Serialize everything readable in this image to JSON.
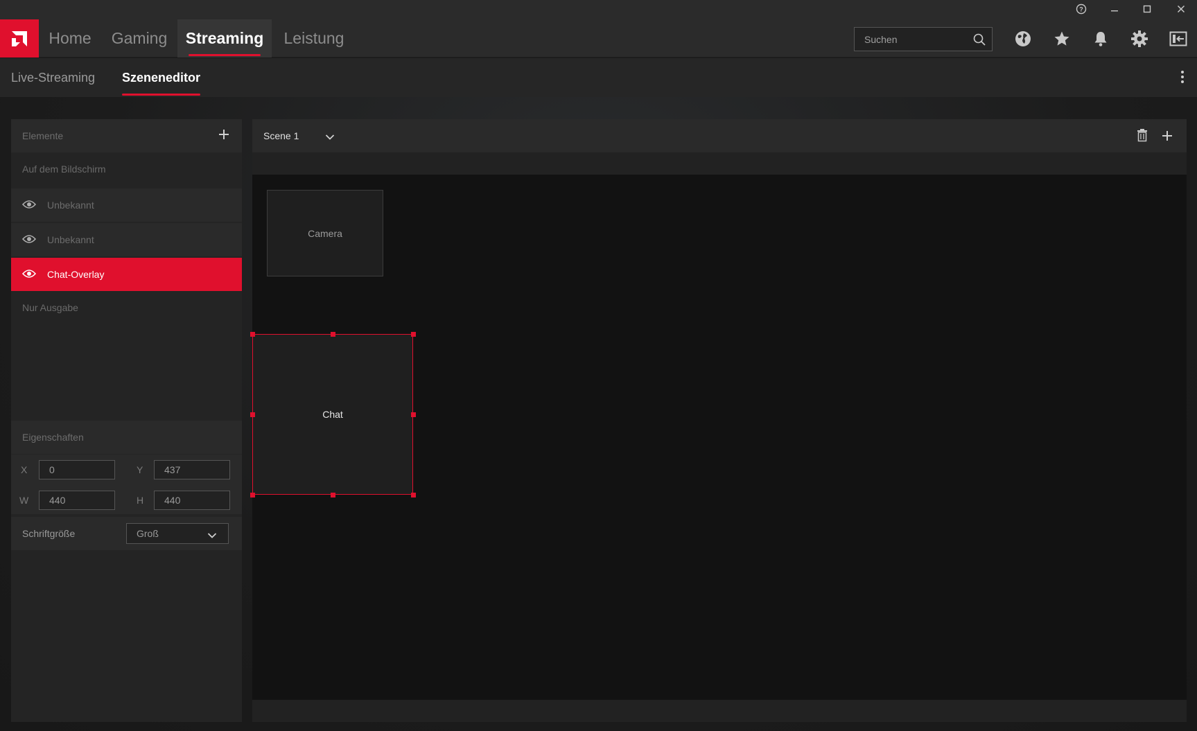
{
  "window": {
    "controls": {
      "help": "?",
      "minimize": "–",
      "maximize": "☐",
      "close": "✕"
    }
  },
  "nav": {
    "tabs": [
      {
        "label": "Home",
        "active": false
      },
      {
        "label": "Gaming",
        "active": false
      },
      {
        "label": "Streaming",
        "active": true
      },
      {
        "label": "Leistung",
        "active": false
      }
    ],
    "search_placeholder": "Suchen",
    "icons": [
      "globe-icon",
      "star-icon",
      "bell-icon",
      "gear-icon",
      "panel-collapse-icon"
    ]
  },
  "subnav": {
    "tabs": [
      {
        "label": "Live-Streaming",
        "active": false
      },
      {
        "label": "Szeneneditor",
        "active": true
      }
    ]
  },
  "elements_panel": {
    "title": "Elemente",
    "on_screen_label": "Auf dem Bildschirm",
    "items": [
      {
        "label": "Unbekannt",
        "selected": false
      },
      {
        "label": "Unbekannt",
        "selected": false
      },
      {
        "label": "Chat-Overlay",
        "selected": true
      }
    ],
    "output_only_label": "Nur Ausgabe"
  },
  "properties": {
    "title": "Eigenschaften",
    "x_label": "X",
    "x_value": "0",
    "y_label": "Y",
    "y_value": "437",
    "w_label": "W",
    "w_value": "440",
    "h_label": "H",
    "h_value": "440",
    "font_size_label": "Schriftgröße",
    "font_size_value": "Groß"
  },
  "scene": {
    "name": "Scene 1",
    "camera_label": "Camera",
    "chat_label": "Chat"
  },
  "colors": {
    "accent": "#e0102d",
    "background": "#1b1b1b",
    "canvas": "#121212"
  }
}
